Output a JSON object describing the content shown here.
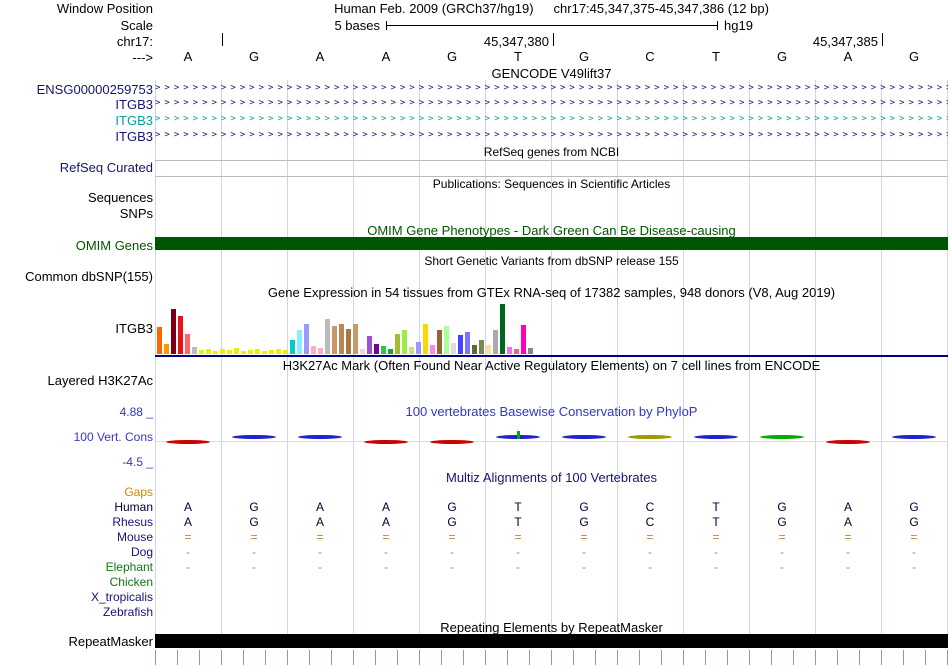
{
  "colors": {
    "gridline": "#CCD6EE",
    "navy": "#14147A",
    "teal": "#00A0A0",
    "dark_green": "#005500",
    "track_line": "#000080",
    "separator": "#BBBBBB",
    "ruler_tick": "#8899BB",
    "repeat_bar": "#000000"
  },
  "header": {
    "assembly": "Human Feb. 2009 (GRCh37/hg19)",
    "position": "chr17:45,347,375-45,347,386 (12 bp)",
    "scale_label": "5 bases",
    "scale_right": "hg19",
    "coord_left": "45,347,380",
    "coord_right": "45,347,385"
  },
  "ruler_bases": [
    "A",
    "G",
    "A",
    "A",
    "G",
    "T",
    "G",
    "C",
    "T",
    "G",
    "A",
    "G"
  ],
  "left_labels": [
    {
      "id": "window-position",
      "text": "Window Position",
      "color": "#000000"
    },
    {
      "id": "scale",
      "text": "Scale",
      "color": "#000000"
    },
    {
      "id": "chrom",
      "text": "chr17:",
      "color": "#000000"
    },
    {
      "id": "strand",
      "text": "--->",
      "color": "#000000"
    },
    {
      "id": "gene-ensg",
      "text": "ENSG00000259753",
      "color": "#14147A"
    },
    {
      "id": "gene-itgb3-a",
      "text": "ITGB3",
      "color": "#14147A"
    },
    {
      "id": "gene-itgb3-b",
      "text": "ITGB3",
      "color": "#00A0A0"
    },
    {
      "id": "gene-itgb3-c",
      "text": "ITGB3",
      "color": "#14147A"
    },
    {
      "id": "refseq-curated",
      "text": "RefSeq Curated",
      "color": "#14147A"
    },
    {
      "id": "sequences",
      "text": "Sequences",
      "color": "#000000"
    },
    {
      "id": "snps",
      "text": "SNPs",
      "color": "#000000"
    },
    {
      "id": "omim-genes",
      "text": "OMIM Genes",
      "color": "#005500"
    },
    {
      "id": "common-dbsnp",
      "text": "Common dbSNP(155)",
      "color": "#000000"
    },
    {
      "id": "gtex-gene",
      "text": "ITGB3",
      "color": "#000000"
    },
    {
      "id": "layered-h3k27ac",
      "text": "Layered H3K27Ac",
      "color": "#000000"
    },
    {
      "id": "cons-max",
      "text": "4.88 _",
      "color": "#3535CC"
    },
    {
      "id": "cons-name",
      "text": "100 Vert. Cons",
      "color": "#3535CC"
    },
    {
      "id": "cons-min",
      "text": "-4.5 _",
      "color": "#3535CC"
    },
    {
      "id": "gaps",
      "text": "Gaps",
      "color": "#CC8800"
    },
    {
      "id": "human",
      "text": "Human",
      "color": "#000033"
    },
    {
      "id": "rhesus",
      "text": "Rhesus",
      "color": "#14147A"
    },
    {
      "id": "mouse",
      "text": "Mouse",
      "color": "#14147A"
    },
    {
      "id": "dog",
      "text": "Dog",
      "color": "#14147A"
    },
    {
      "id": "elephant",
      "text": "Elephant",
      "color": "#117711"
    },
    {
      "id": "chicken",
      "text": "Chicken",
      "color": "#117711"
    },
    {
      "id": "x-tropicalis",
      "text": "X_tropicalis",
      "color": "#14147A"
    },
    {
      "id": "zebrafish",
      "text": "Zebrafish",
      "color": "#14147A"
    },
    {
      "id": "repeatmasker",
      "text": "RepeatMasker",
      "color": "#000000"
    }
  ],
  "center_headers": [
    {
      "id": "gencode",
      "text": "GENCODE V49lift37",
      "color": "#000000"
    },
    {
      "id": "refseq",
      "text": "RefSeq genes from NCBI",
      "color": "#000000"
    },
    {
      "id": "publications",
      "text": "Publications: Sequences in Scientific Articles",
      "color": "#000000"
    },
    {
      "id": "omim",
      "text": "OMIM Gene Phenotypes - Dark Green Can Be Disease-causing",
      "color": "#005500"
    },
    {
      "id": "dbsnp",
      "text": "Short Genetic Variants from dbSNP release 155",
      "color": "#000000"
    },
    {
      "id": "gtex",
      "text": "Gene Expression in 54 tissues from GTEx RNA-seq of 17382 samples, 948 donors (V8, Aug 2019)",
      "color": "#000000"
    },
    {
      "id": "h3k27ac",
      "text": "H3K27Ac Mark (Often Found Near Active Regulatory Elements) on 7 cell lines from ENCODE",
      "color": "#000000"
    },
    {
      "id": "phylop",
      "text": "100 vertebrates Basewise Conservation by PhyloP",
      "color": "#3535CC"
    },
    {
      "id": "multiz",
      "text": "Multiz Alignments of 100 Vertebrates",
      "color": "#14147A"
    },
    {
      "id": "repeat",
      "text": "Repeating Elements by RepeatMasker",
      "color": "#000000"
    }
  ],
  "gencode": {
    "arrow_char": ">",
    "rows": [
      {
        "id": "ensg00000259753",
        "color": "#14147A"
      },
      {
        "id": "itgb3-a",
        "color": "#14147A"
      },
      {
        "id": "itgb3-b",
        "color": "#00A0A0"
      },
      {
        "id": "itgb3-c",
        "color": "#14147A"
      }
    ]
  },
  "gtex_chart": {
    "type": "bar",
    "gene": "ITGB3",
    "title": "Gene Expression in 54 tissues from GTEx RNA-seq of 17382 samples, 948 donors (V8, Aug 2019)",
    "tissue_count": 54,
    "values": [
      27,
      10,
      45,
      38,
      20,
      7,
      4,
      5,
      3,
      5,
      4,
      6,
      3,
      4,
      5,
      3,
      4,
      5,
      4,
      14,
      24,
      30,
      8,
      6,
      35,
      28,
      30,
      25,
      30,
      5,
      18,
      10,
      8,
      5,
      20,
      24,
      7,
      12,
      30,
      9,
      24,
      28,
      11,
      19,
      22,
      9,
      14,
      9,
      24,
      50,
      7,
      5,
      29,
      6
    ],
    "colors": [
      "#FF6600",
      "#FF9900",
      "#7A0019",
      "#EE1111",
      "#FF6666",
      "#BBBBBB",
      "#EEEE00",
      "#EEEE00",
      "#EEEE00",
      "#EEEE00",
      "#EEEE00",
      "#EEEE00",
      "#EEEE00",
      "#EEEE00",
      "#EEEE00",
      "#EEEE00",
      "#EEEE00",
      "#EEEE00",
      "#EEEE00",
      "#00CCCC",
      "#88EEFF",
      "#9999FF",
      "#FFAACC",
      "#FFAACC",
      "#BBBBBB",
      "#CC9966",
      "#BB8855",
      "#AA7744",
      "#C49A6C",
      "#FFCCEE",
      "#9955CC",
      "#770099",
      "#22CC44",
      "#11AA33",
      "#AABB33",
      "#99EE44",
      "#CCDD88",
      "#9999FF",
      "#FFD700",
      "#FF88EE",
      "#996633",
      "#AAFF99",
      "#DDDDDD",
      "#4444FF",
      "#7777FF",
      "#666633",
      "#778855",
      "#FFDD99",
      "#AAAAAA",
      "#006622",
      "#FF66FF",
      "#FF5599",
      "#FF00BB",
      "#888888"
    ]
  },
  "conservation": {
    "marks": [
      {
        "color": "#CC0000",
        "dir": "down"
      },
      {
        "color": "#2222CC",
        "dir": "up"
      },
      {
        "color": "#2222CC",
        "dir": "up"
      },
      {
        "color": "#CC0000",
        "dir": "down"
      },
      {
        "color": "#CC0000",
        "dir": "down"
      },
      {
        "color": "#2222CC",
        "dir": "up"
      },
      {
        "color": "#2222CC",
        "dir": "up"
      },
      {
        "color": "#999900",
        "dir": "up"
      },
      {
        "color": "#2222CC",
        "dir": "up"
      },
      {
        "color": "#00AA00",
        "dir": "up"
      },
      {
        "color": "#CC0000",
        "dir": "down"
      },
      {
        "color": "#2222CC",
        "dir": "up"
      }
    ],
    "tick_column": 5,
    "tick_color": "#00AA00"
  },
  "multiz": {
    "cells": {
      "human": [
        "A",
        "G",
        "A",
        "A",
        "G",
        "T",
        "G",
        "C",
        "T",
        "G",
        "A",
        "G"
      ],
      "rhesus": [
        "A",
        "G",
        "A",
        "A",
        "G",
        "T",
        "G",
        "C",
        "T",
        "G",
        "A",
        "G"
      ],
      "mouse": [
        "=",
        "=",
        "=",
        "=",
        "=",
        "=",
        "=",
        "=",
        "=",
        "=",
        "=",
        "="
      ],
      "dog": [
        "-",
        "-",
        "-",
        "-",
        "-",
        "-",
        "-",
        "-",
        "-",
        "-",
        "-",
        "-"
      ],
      "elephant": [
        "-",
        "-",
        "-",
        "-",
        "-",
        "-",
        "-",
        "-",
        "-",
        "-",
        "-",
        "-"
      ],
      "chicken": [],
      "x_tropicalis": [],
      "zebrafish": []
    },
    "cell_colors": {
      "human": "#000033",
      "rhesus": "#000033",
      "mouse": "#BB8833",
      "dog": "#888888",
      "elephant": "#888888"
    }
  }
}
